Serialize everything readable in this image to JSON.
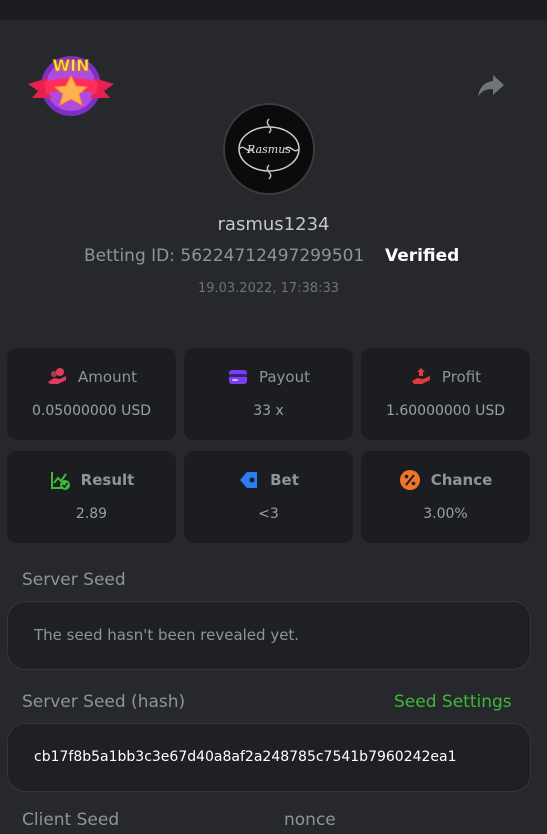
{
  "header": {
    "badge_text": "WIN"
  },
  "profile": {
    "username": "rasmus1234",
    "betting_id_label": "Betting ID:",
    "betting_id": "56224712497299501",
    "verified_label": "Verified",
    "timestamp": "19.03.2022, 17:38:33",
    "avatar_icon": "the-rasmus-logo"
  },
  "stats": [
    {
      "label": "Amount",
      "value": "0.05000000 USD",
      "icon": "coins-hand-icon",
      "color": "#e03a5c"
    },
    {
      "label": "Payout",
      "value": "33 x",
      "icon": "wallet-card-icon",
      "color": "#7b3ff2"
    },
    {
      "label": "Profit",
      "value": "1.60000000 USD",
      "icon": "profit-hand-icon",
      "color": "#e03a3a"
    },
    {
      "label": "Result",
      "value": "2.89",
      "icon": "chart-check-icon",
      "color": "#3fb83a"
    },
    {
      "label": "Bet",
      "value": "<3",
      "icon": "tag-icon",
      "color": "#2d7bf0"
    },
    {
      "label": "Chance",
      "value": "3.00%",
      "icon": "percent-icon",
      "color": "#f2742b"
    }
  ],
  "server_seed": {
    "label": "Server Seed",
    "value": "The seed hasn't been revealed yet."
  },
  "server_seed_hash": {
    "label": "Server Seed (hash)",
    "settings_link": "Seed Settings",
    "value": "cb17f8b5a1bb3c3e67d40a8af2a248785c7541b7960242ea1"
  },
  "client_seed": {
    "label": "Client Seed",
    "nonce_label": "nonce"
  }
}
